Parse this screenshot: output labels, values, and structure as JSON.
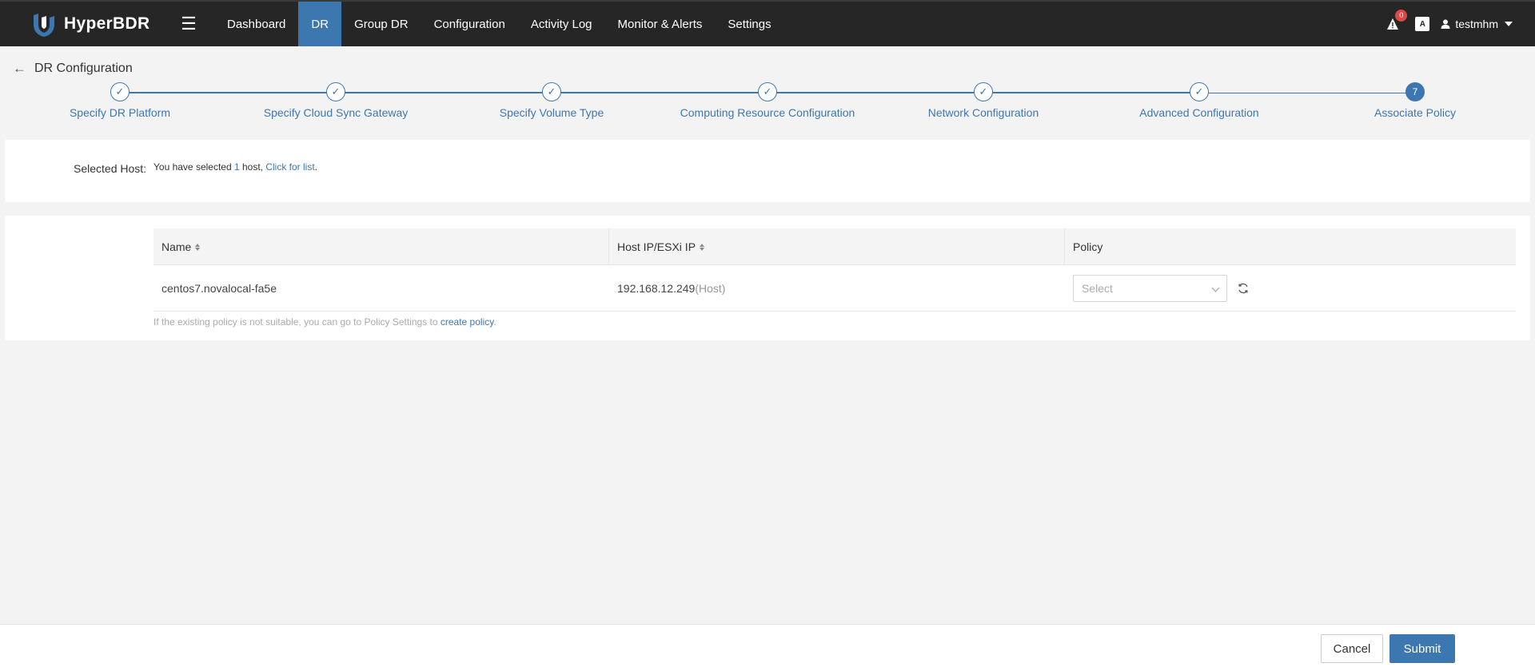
{
  "app": {
    "name": "HyperBDR",
    "menu_icon": "hamburger-icon"
  },
  "nav": {
    "items": [
      {
        "label": "Dashboard",
        "active": false
      },
      {
        "label": "DR",
        "active": true
      },
      {
        "label": "Group DR",
        "active": false
      },
      {
        "label": "Configuration",
        "active": false
      },
      {
        "label": "Activity Log",
        "active": false
      },
      {
        "label": "Monitor & Alerts",
        "active": false
      },
      {
        "label": "Settings",
        "active": false
      }
    ],
    "alert_count": "0",
    "lang_icon_text": "A",
    "username": "testmhm"
  },
  "page": {
    "title": "DR Configuration",
    "back_icon": "arrow-left-icon"
  },
  "steps": [
    {
      "label": "Specify DR Platform",
      "status": "done"
    },
    {
      "label": "Specify Cloud Sync Gateway",
      "status": "done"
    },
    {
      "label": "Specify Volume Type",
      "status": "done"
    },
    {
      "label": "Computing Resource Configuration",
      "status": "done"
    },
    {
      "label": "Network Configuration",
      "status": "done"
    },
    {
      "label": "Advanced Configuration",
      "status": "done"
    },
    {
      "label": "Associate Policy",
      "status": "current",
      "number": "7"
    }
  ],
  "selected_host": {
    "label": "Selected Host:",
    "prefix": "You have selected ",
    "count": "1",
    "suffix": " host, ",
    "link": "Click for list",
    "end": "."
  },
  "table": {
    "columns": [
      "Name",
      "Host IP/ESXi IP",
      "Policy"
    ],
    "rows": [
      {
        "name": "centos7.novalocal-fa5e",
        "ip": "192.168.12.249",
        "ip_suffix": "(Host)",
        "policy_placeholder": "Select"
      }
    ],
    "hint_prefix": "If the existing policy is not suitable, you can go to Policy Settings to ",
    "hint_link": "create policy",
    "hint_end": "."
  },
  "footer": {
    "cancel_label": "Cancel",
    "submit_label": "Submit"
  },
  "colors": {
    "accent": "#3d77b0",
    "topbar": "#262626",
    "alert_badge": "#e04848"
  }
}
